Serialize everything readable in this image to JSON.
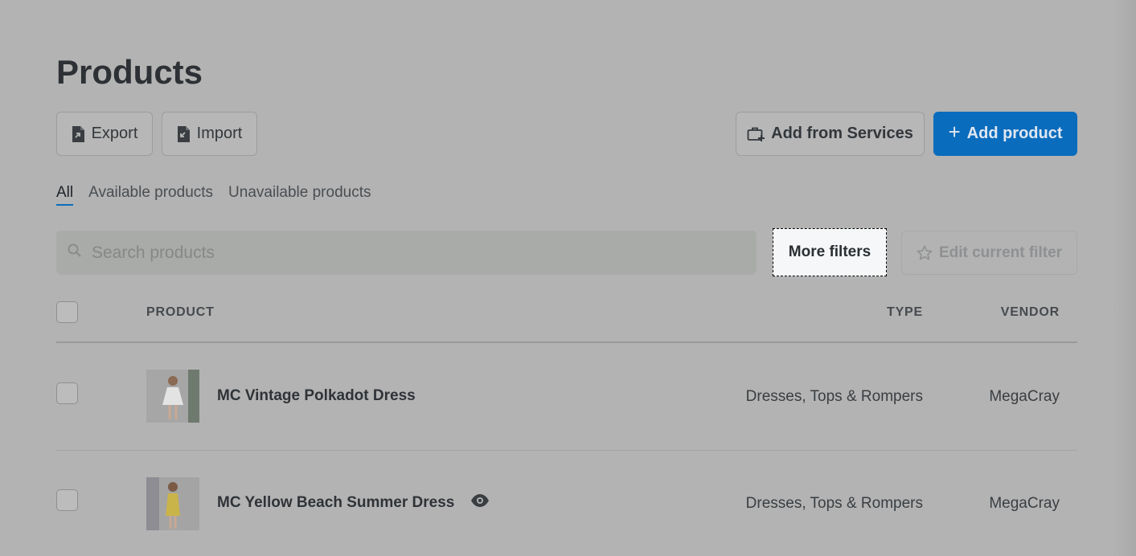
{
  "page": {
    "title": "Products"
  },
  "toolbar": {
    "export_label": "Export",
    "import_label": "Import",
    "add_services_label": "Add from Services",
    "add_product_label": "Add product"
  },
  "tabs": [
    {
      "label": "All",
      "active": true
    },
    {
      "label": "Available products",
      "active": false
    },
    {
      "label": "Unavailable products",
      "active": false
    }
  ],
  "filters": {
    "search_placeholder": "Search products",
    "more_filters_label": "More filters",
    "edit_filter_label": "Edit current filter"
  },
  "table": {
    "columns": {
      "product": "PRODUCT",
      "type": "TYPE",
      "vendor": "VENDOR"
    },
    "rows": [
      {
        "name": "MC Vintage Polkadot Dress",
        "type": "Dresses, Tops & Rompers",
        "vendor": "MegaCray",
        "preview_icon": false
      },
      {
        "name": "MC Yellow Beach Summer Dress",
        "type": "Dresses, Tops & Rompers",
        "vendor": "MegaCray",
        "preview_icon": true
      }
    ]
  },
  "colors": {
    "accent": "#0a6cbd",
    "overlay": "#b3b3b3"
  }
}
